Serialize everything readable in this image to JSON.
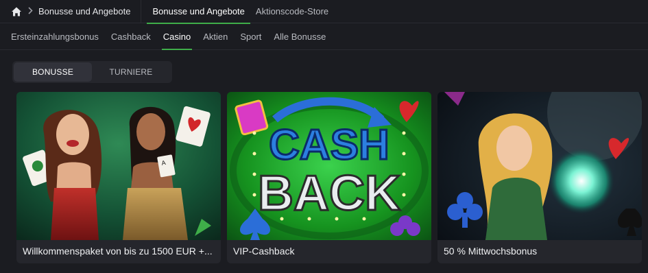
{
  "breadcrumb": {
    "current": "Bonusse und Angebote"
  },
  "top_tabs": [
    {
      "label": "Bonusse und Angebote",
      "active": true
    },
    {
      "label": "Aktionscode-Store",
      "active": false
    }
  ],
  "categories": [
    {
      "label": "Ersteinzahlungsbonus",
      "active": false
    },
    {
      "label": "Cashback",
      "active": false
    },
    {
      "label": "Casino",
      "active": true
    },
    {
      "label": "Aktien",
      "active": false
    },
    {
      "label": "Sport",
      "active": false
    },
    {
      "label": "Alle Bonusse",
      "active": false
    }
  ],
  "segment": {
    "bonuses": "BONUSSE",
    "tournaments": "TURNIERE",
    "active": "bonuses"
  },
  "cards": [
    {
      "title": "Willkommenspaket von bis zu 1500 EUR +..."
    },
    {
      "title": "VIP-Cashback",
      "image_text": [
        "CASH",
        "BACK"
      ]
    },
    {
      "title": "50 % Mittwochsbonus"
    }
  ],
  "colors": {
    "background": "#1b1c21",
    "accent": "#3fae49",
    "card": "#25262c"
  },
  "icons": {
    "home": "home-icon",
    "separator": "chevron-right-icon"
  }
}
